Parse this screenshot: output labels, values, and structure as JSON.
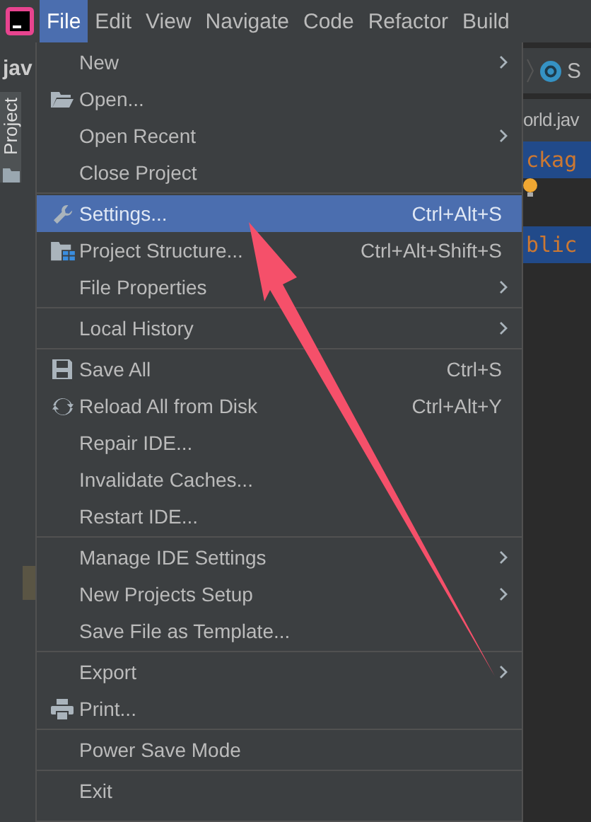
{
  "menubar": [
    {
      "label": "File",
      "selected": true
    },
    {
      "label": "Edit",
      "selected": false
    },
    {
      "label": "View",
      "selected": false
    },
    {
      "label": "Navigate",
      "selected": false
    },
    {
      "label": "Code",
      "selected": false
    },
    {
      "label": "Refactor",
      "selected": false
    },
    {
      "label": "Build",
      "selected": false
    }
  ],
  "left_panel": {
    "project_name": "jav",
    "tool_window": "Project"
  },
  "editor": {
    "breadcrumb": "S",
    "file_tab": "orld.jav",
    "code_lines": [
      "ckag",
      "blic"
    ]
  },
  "menu": [
    [
      {
        "label": "New",
        "kind": "plain",
        "submenu": true,
        "selected": false
      },
      {
        "label": "Open...",
        "kind": "open",
        "submenu": false,
        "selected": false
      },
      {
        "label": "Open Recent",
        "kind": "plain",
        "submenu": true,
        "selected": false
      },
      {
        "label": "Close Project",
        "kind": "plain",
        "submenu": false,
        "selected": false
      }
    ],
    [
      {
        "label": "Settings...",
        "kind": "settings",
        "shortcut": "Ctrl+Alt+S",
        "submenu": false,
        "selected": true
      },
      {
        "label": "Project Structure...",
        "kind": "structure",
        "shortcut": "Ctrl+Alt+Shift+S",
        "submenu": false,
        "selected": false
      },
      {
        "label": "File Properties",
        "kind": "plain",
        "submenu": true,
        "selected": false
      }
    ],
    [
      {
        "label": "Local History",
        "kind": "plain",
        "submenu": true,
        "selected": false
      }
    ],
    [
      {
        "label": "Save All",
        "kind": "save",
        "shortcut": "Ctrl+S",
        "submenu": false,
        "selected": false
      },
      {
        "label": "Reload All from Disk",
        "kind": "reload",
        "shortcut": "Ctrl+Alt+Y",
        "submenu": false,
        "selected": false
      },
      {
        "label": "Repair IDE...",
        "kind": "plain",
        "submenu": false,
        "selected": false
      },
      {
        "label": "Invalidate Caches...",
        "kind": "plain",
        "submenu": false,
        "selected": false
      },
      {
        "label": "Restart IDE...",
        "kind": "plain",
        "submenu": false,
        "selected": false
      }
    ],
    [
      {
        "label": "Manage IDE Settings",
        "kind": "plain",
        "submenu": true,
        "selected": false
      },
      {
        "label": "New Projects Setup",
        "kind": "plain",
        "submenu": true,
        "selected": false
      },
      {
        "label": "Save File as Template...",
        "kind": "plain",
        "submenu": false,
        "selected": false
      }
    ],
    [
      {
        "label": "Export",
        "kind": "plain",
        "submenu": true,
        "selected": false
      },
      {
        "label": "Print...",
        "kind": "print",
        "submenu": false,
        "selected": false
      }
    ],
    [
      {
        "label": "Power Save Mode",
        "kind": "plain",
        "submenu": false,
        "selected": false
      }
    ],
    [
      {
        "label": "Exit",
        "kind": "plain",
        "submenu": false,
        "selected": false
      }
    ]
  ]
}
